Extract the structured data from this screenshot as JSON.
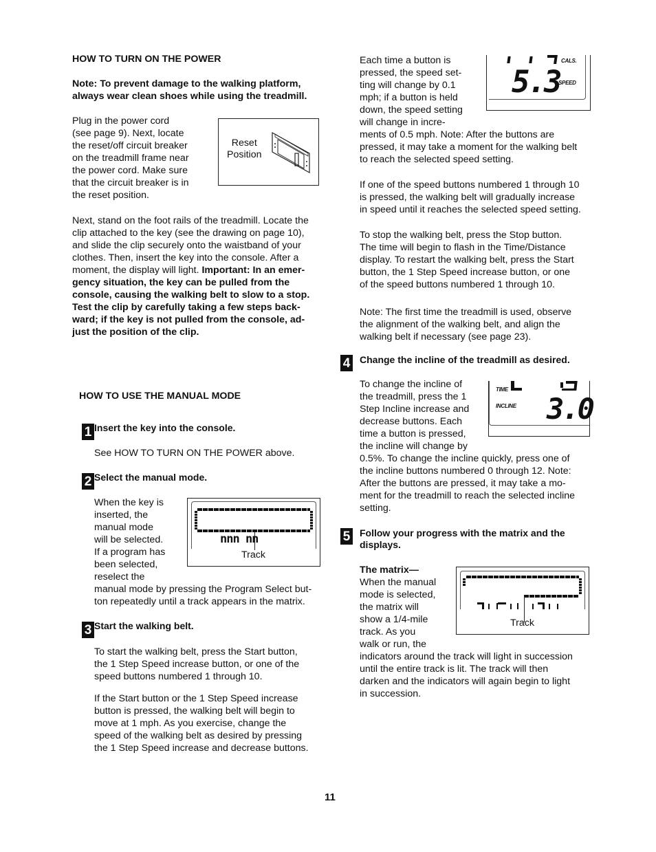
{
  "left": {
    "power": {
      "heading": "HOW TO TURN ON THE POWER",
      "note": [
        "Note: To prevent damage to the walking platform,",
        "always wear clean shoes while using the treadmill."
      ],
      "plug_lines": [
        "Plug in the power cord",
        "(see page 9). Next, locate",
        "the reset/off circuit breaker",
        "on the treadmill frame near",
        "the power cord. Make sure",
        "that the circuit breaker is in",
        "the reset position."
      ],
      "figure_label": [
        "Reset",
        "Position"
      ],
      "next_lines_regular": [
        "Next, stand on the foot rails of the treadmill. Locate the",
        "clip attached to the key (see the drawing on page 10),",
        "and slide the clip securely onto the waistband of your",
        "clothes. Then, insert the key into the console. After a"
      ],
      "next_line5_regular": "moment, the display will light. ",
      "next_line5_bold": "Important: In an emer-",
      "next_lines_bold": [
        "gency situation, the key can be pulled from the",
        "console, causing the walking belt to slow to a stop.",
        "Test the clip by carefully taking a few steps back-",
        "ward; if the key is not pulled from the console, ad-",
        "just the position of the clip."
      ]
    },
    "manual": {
      "heading": "HOW TO USE THE MANUAL MODE",
      "step1": {
        "num": "1",
        "title": "Insert the key into the console.",
        "body": "See HOW TO TURN ON THE POWER above."
      },
      "step2": {
        "num": "2",
        "title": "Select the manual mode.",
        "wrap_lines": [
          "When the key is",
          "inserted, the",
          "manual mode",
          "will be selected.",
          "If a program has",
          "been selected,",
          "reselect the"
        ],
        "full_lines": [
          "manual mode by pressing the Program Select but-",
          "ton repeatedly until a track appears in the matrix."
        ],
        "figure_label": "Track",
        "figure_digits": "nnn    nn"
      },
      "step3": {
        "num": "3",
        "title": "Start the walking belt.",
        "para1": [
          "To start the walking belt, press the Start button,",
          "the 1 Step Speed increase button, or one of the",
          "speed buttons numbered 1 through 10."
        ],
        "para2": [
          "If the Start button or the 1 Step Speed increase",
          "button is pressed, the walking belt will begin to",
          "move at 1 mph. As you exercise, change the",
          "speed of the walking belt as desired by pressing",
          "the 1 Step Speed increase and decrease buttons."
        ]
      }
    }
  },
  "right": {
    "speed": {
      "wrap_lines": [
        "Each time a button is",
        "pressed, the speed set-",
        "ting will change by 0.1",
        "mph; if a button is held",
        "down, the speed setting",
        "will change in incre-"
      ],
      "full_lines": [
        "ments of 0.5 mph. Note: After the buttons are",
        "pressed, it may take a moment for the walking belt",
        "to reach the selected speed setting."
      ],
      "display": {
        "top_label": "CALS.",
        "value": "5.3",
        "value_label": "SPEED"
      }
    },
    "para_buttons": [
      "If one of the speed buttons numbered 1 through 10",
      "is pressed, the walking belt will gradually increase",
      "in speed until it reaches the selected speed setting."
    ],
    "para_stop": [
      "To stop the walking belt, press the Stop button.",
      "The time will begin to flash in the Time/Distance",
      "display. To restart the walking belt, press the Start",
      "button, the 1 Step Speed increase button, or one",
      "of the speed buttons numbered 1 through 10."
    ],
    "para_note": [
      "Note: The first time the treadmill is used, observe",
      "the alignment of the walking belt, and align the",
      "walking belt if necessary (see page 23)."
    ],
    "step4": {
      "num": "4",
      "title": "Change the incline of the treadmill as desired.",
      "wrap_lines": [
        "To change the incline of",
        "the treadmill, press the 1",
        "Step Incline increase and",
        "decrease buttons. Each",
        "time a button is pressed,",
        "the incline will change by"
      ],
      "full_lines": [
        "0.5%. To change the incline quickly, press one of",
        "the incline buttons numbered 0 through 12. Note:",
        "After the buttons are pressed, it may take a mo-",
        "ment for the treadmill to reach the selected incline",
        "setting."
      ],
      "display": {
        "top_label": "TIME",
        "value_label": "INCLINE",
        "value": "3.0"
      }
    },
    "step5": {
      "num": "5",
      "title": [
        "Follow your progress with the matrix and the",
        "displays."
      ],
      "subheading": "The matrix—",
      "wrap_lines": [
        "When the manual",
        "mode is selected,",
        "the matrix will",
        "show a 1/4-mile",
        "track. As you",
        "walk or run, the"
      ],
      "full_lines": [
        "indicators around the track will light in succession",
        "until the entire track is lit. The track will then",
        "darken and the indicators will again begin to light",
        "in succession."
      ],
      "figure_label": "Track"
    }
  },
  "page_number": "11"
}
